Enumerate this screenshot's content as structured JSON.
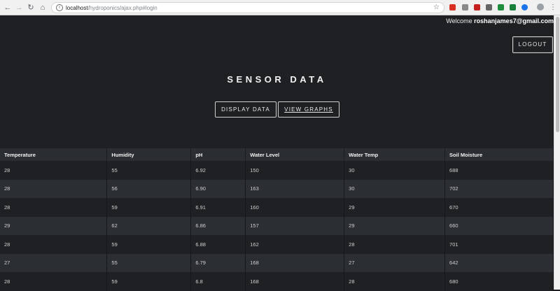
{
  "browser": {
    "url_host": "localhost",
    "url_path": "/hydroponics/ajax.php#login"
  },
  "header": {
    "welcome_prefix": "Welcome",
    "welcome_email": "roshanjames7@gmail.com",
    "logout_label": "LOGOUT"
  },
  "main": {
    "title": "SENSOR DATA",
    "display_label": "DISPLAY DATA",
    "graphs_label": "VIEW GRAPHS"
  },
  "table": {
    "headers": [
      "Temperature",
      "Humidity",
      "pH",
      "Water Level",
      "Water Temp",
      "Soil Moisture"
    ],
    "rows": [
      [
        "28",
        "55",
        "6.92",
        "150",
        "30",
        "688"
      ],
      [
        "28",
        "56",
        "6.90",
        "163",
        "30",
        "702"
      ],
      [
        "28",
        "59",
        "6.91",
        "160",
        "29",
        "670"
      ],
      [
        "29",
        "62",
        "6.86",
        "157",
        "29",
        "660"
      ],
      [
        "28",
        "59",
        "6.88",
        "162",
        "28",
        "701"
      ],
      [
        "27",
        "55",
        "6.79",
        "168",
        "27",
        "642"
      ],
      [
        "28",
        "59",
        "6.8",
        "168",
        "28",
        "680"
      ]
    ]
  }
}
